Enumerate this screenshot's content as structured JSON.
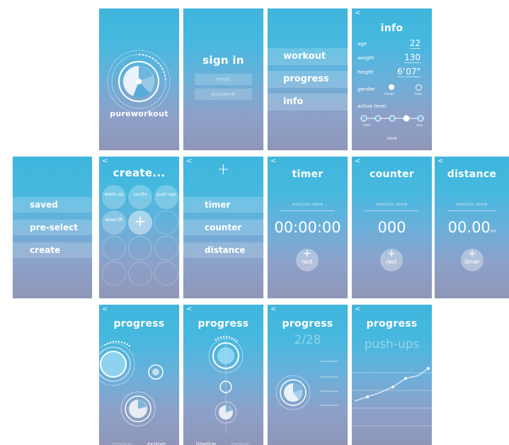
{
  "screens": {
    "logo": {
      "app_name": "pureworkout"
    },
    "signin": {
      "title": "sign in",
      "email_placeholder": "email",
      "password_placeholder": "password"
    },
    "main_menu": {
      "items": [
        "workout",
        "progress",
        "info"
      ]
    },
    "info": {
      "back": "<",
      "title": "info",
      "age_label": "age",
      "age_value": "22",
      "weight_label": "weight",
      "weight_value": "130",
      "height_label": "height",
      "height_ft": "6'",
      "height_in": "07\"",
      "gender_label": "gender",
      "gender_female": "female",
      "gender_male": "male",
      "active_label": "active level",
      "active_min": "none",
      "active_max": "very",
      "save": "save"
    },
    "workout_menu": {
      "items": [
        "saved",
        "pre-select",
        "create"
      ]
    },
    "create": {
      "back": "<",
      "title": "create...",
      "circles": [
        "warm up",
        "cardio",
        "push ups",
        "dead lift"
      ]
    },
    "type_menu": {
      "back": "<",
      "plus": "+",
      "items": [
        "timer",
        "counter",
        "distance"
      ]
    },
    "timer": {
      "back": "<",
      "title": "timer",
      "field": "exercise name",
      "value": "00:00:00",
      "btn": "rest"
    },
    "counter": {
      "back": "<",
      "title": "counter",
      "field": "exercise name",
      "value": "000",
      "btn": "rest"
    },
    "distance": {
      "back": "<",
      "title": "distance",
      "field": "exercise name",
      "value": "00.00",
      "unit": "mi",
      "btn": "timer"
    },
    "progress1": {
      "back": "<",
      "title": "progress",
      "tab1": "timeline",
      "tab2": "explore"
    },
    "progress2": {
      "back": "<",
      "title": "progress",
      "tab1": "timeline",
      "tab2": "explore"
    },
    "progress3": {
      "back": "<",
      "title": "progress",
      "fraction": "2/28"
    },
    "progress4": {
      "back": "<",
      "title": "progress",
      "subtitle": "push-ups"
    }
  },
  "colors": {
    "accent": "#3fb6dd",
    "bottom": "#8f96b8"
  }
}
